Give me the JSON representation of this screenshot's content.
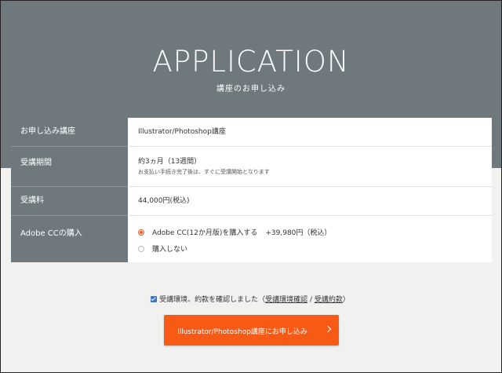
{
  "header": {
    "title": "APPLICATION",
    "subtitle": "講座のお申し込み"
  },
  "form": {
    "rows": [
      {
        "label": "お申し込み講座",
        "value": "Illustrator/Photoshop講座"
      },
      {
        "label": "受講期間",
        "value": "約3ヵ月（13週間）",
        "note": "お支払い手続き完了後は、すぐに受講開始となります"
      },
      {
        "label": "受講料",
        "value": "44,000円(税込)"
      },
      {
        "label": "Adobe CCの購入"
      }
    ],
    "adobe_options": [
      {
        "label": "Adobe CC(12か月版)を購入する",
        "price": "+39,980円（税込）",
        "selected": true
      },
      {
        "label": "購入しない",
        "selected": false
      }
    ]
  },
  "agreement": {
    "checked": true,
    "text": "受講環境、約款を確認しました（",
    "link_env": "受講環境確認",
    "separator": " / ",
    "link_terms": "受講約款",
    "close": "）"
  },
  "submit": {
    "label": "Illustrator/Photoshop講座にお申し込み"
  },
  "colors": {
    "header_bg": "#6f787c",
    "accent": "#f75a14",
    "checkbox": "#3b73c6"
  }
}
